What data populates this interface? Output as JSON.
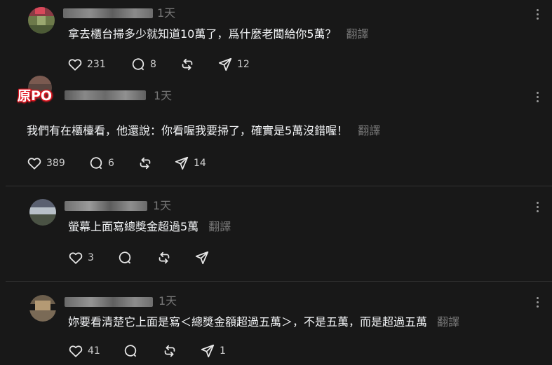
{
  "badge": {
    "label": "原PO"
  },
  "comments": [
    {
      "time": "1天",
      "text": "拿去櫃台掃多少就知道10萬了，爲什麼老闆給你5萬？",
      "translate": "翻譯",
      "likes": "231",
      "replies": "8",
      "reposts": "",
      "shares": "12"
    },
    {
      "time": "1天",
      "text": "我們有在櫃檯看，他還說：你看喔我要掃了，確實是5萬沒錯喔！",
      "translate": "翻譯",
      "likes": "389",
      "replies": "6",
      "reposts": "",
      "shares": "14"
    },
    {
      "time": "1天",
      "text": "螢幕上面寫總獎金超過5萬",
      "translate": "翻譯",
      "likes": "3",
      "replies": "",
      "reposts": "",
      "shares": ""
    },
    {
      "time": "1天",
      "text": "妳要看清楚它上面是寫＜總獎金額超過五萬＞，不是五萬，而是超過五萬",
      "translate": "翻譯",
      "likes": "41",
      "replies": "",
      "reposts": "",
      "shares": "1"
    }
  ],
  "icons": {
    "heart": "heart-icon",
    "reply": "comment-icon",
    "repost": "repost-icon",
    "share": "share-icon",
    "more": "more-icon"
  },
  "colors": {
    "background": "#181818",
    "text": "#f3f5f7",
    "muted": "#777777",
    "op_badge": "#e01a24"
  }
}
